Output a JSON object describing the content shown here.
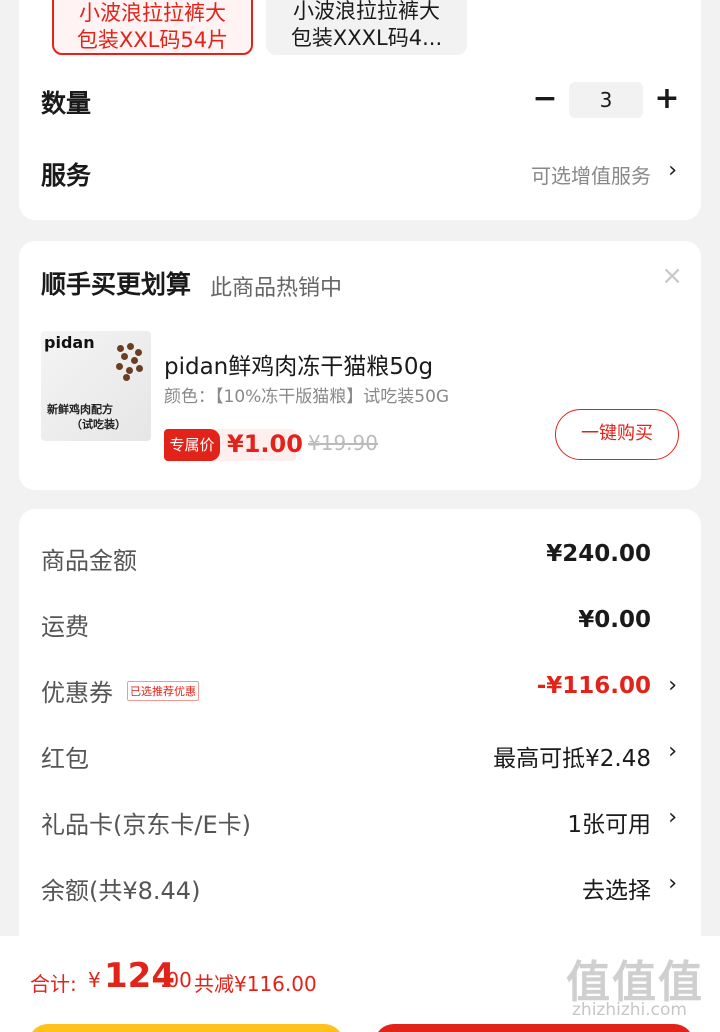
{
  "spec": {
    "variants": [
      {
        "line1": "小波浪拉拉裤大",
        "line2": "包装XXL码54片",
        "selected": true
      },
      {
        "line1": "小波浪拉拉裤大",
        "line2": "包装XXXL码4...",
        "selected": false
      }
    ],
    "quantity_label": "数量",
    "quantity_value": "3",
    "minus": "−",
    "plus": "+",
    "service_label": "服务",
    "service_value": "可选增值服务"
  },
  "recommend": {
    "title": "顺手买更划算",
    "subtitle": "此商品热销中",
    "close": "×",
    "product": {
      "thumb_brand": "pidan",
      "thumb_line1": "新鲜鸡肉配方",
      "thumb_line2": "（试吃装）",
      "name": "pidan鲜鸡肉冻干猫粮50g",
      "spec": "颜色：【10%冻干版猫粮】试吃装50G",
      "price_label": "专属价",
      "price": "¥1.00",
      "old_price": "¥19.90",
      "buy_button": "一键购买"
    }
  },
  "summary": {
    "goods_label": "商品金额",
    "goods_value": "¥240.00",
    "shipping_label": "运费",
    "shipping_value": "¥0.00",
    "coupon_label": "优惠券",
    "coupon_badge": "已选推荐优惠",
    "coupon_value": "-¥116.00",
    "redpacket_label": "红包",
    "redpacket_value": "最高可抵¥2.48",
    "giftcard_label": "礼品卡(京东卡/E卡)",
    "giftcard_value": "1张可用",
    "balance_label": "余额(共¥8.44)",
    "balance_value": "去选择"
  },
  "bottom": {
    "total_label": "合计:",
    "total_yen": "¥",
    "total_int": "124",
    "total_dec": ".00",
    "total_saved": "共减¥116.00",
    "watermark": "值值值",
    "watermark_sub": "zhizhizhi.com"
  },
  "colors": {
    "accent": "#e2231a",
    "secondary_button": "#ffc21a"
  },
  "icons": {
    "chevron": "›",
    "close": "×"
  }
}
